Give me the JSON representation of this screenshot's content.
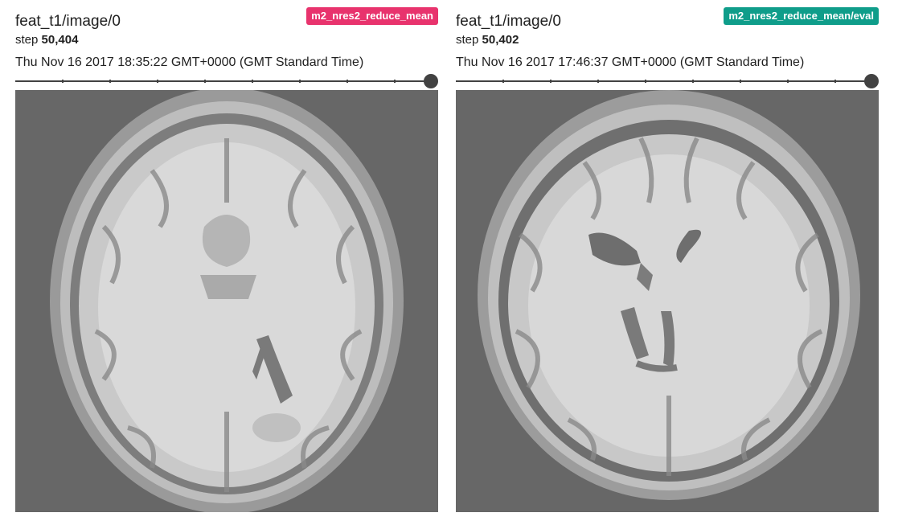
{
  "cards": [
    {
      "tag": "m2_nres2_reduce_mean",
      "tag_color": "#e8336d",
      "title": "feat_t1/image/0",
      "step_label": "step",
      "step_value": "50,404",
      "timestamp": "Thu Nov 16 2017 18:35:22 GMT+0000 (GMT Standard Time)",
      "slider_value": 1.0
    },
    {
      "tag": "m2_nres2_reduce_mean/eval",
      "tag_color": "#0f9d8a",
      "title": "feat_t1/image/0",
      "step_label": "step",
      "step_value": "50,402",
      "timestamp": "Thu Nov 16 2017 17:46:37 GMT+0000 (GMT Standard Time)",
      "slider_value": 1.0
    }
  ]
}
